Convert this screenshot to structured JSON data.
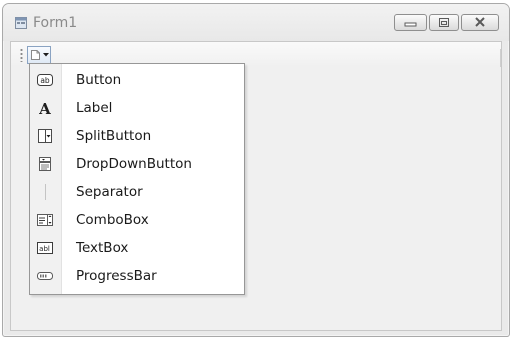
{
  "window": {
    "title": "Form1",
    "icons": {
      "app": "form-window-icon",
      "minimize": "minimize-icon",
      "maximize": "maximize-icon",
      "close": "close-icon"
    }
  },
  "toolstrip": {
    "add_button_icon": "add-item-icon",
    "dropdown_icon": "chevron-down-icon"
  },
  "menu": {
    "items": [
      {
        "label": "Button",
        "icon": "button-icon"
      },
      {
        "label": "Label",
        "icon": "label-icon"
      },
      {
        "label": "SplitButton",
        "icon": "split-button-icon"
      },
      {
        "label": "DropDownButton",
        "icon": "dropdown-button-icon"
      },
      {
        "label": "Separator",
        "icon": "separator-icon"
      },
      {
        "label": "ComboBox",
        "icon": "combobox-icon"
      },
      {
        "label": "TextBox",
        "icon": "textbox-icon"
      },
      {
        "label": "ProgressBar",
        "icon": "progressbar-icon"
      }
    ]
  },
  "colors": {
    "window_bg": "#eaeaea",
    "client_bg": "#f0f0f0",
    "menu_bg": "#ffffff",
    "menu_border": "#979797",
    "title_text": "#8a8a8a"
  }
}
